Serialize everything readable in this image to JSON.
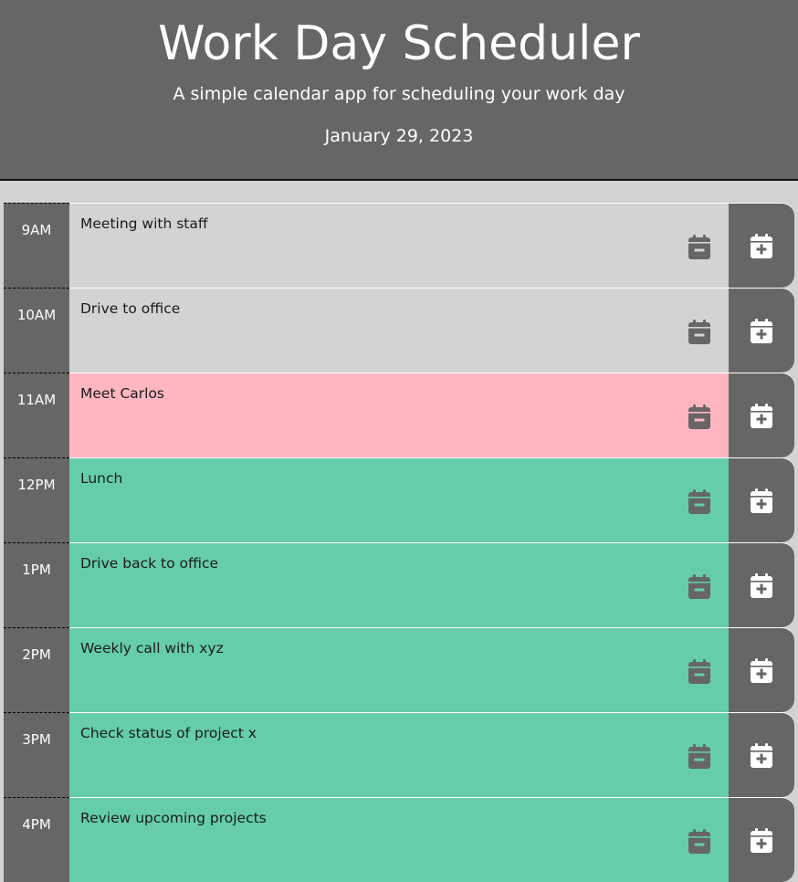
{
  "header": {
    "title": "Work Day Scheduler",
    "subtitle": "A simple calendar app for scheduling your work day",
    "date": "January 29, 2023"
  },
  "colors": {
    "header_bg": "#666666",
    "past": "#d3d3d3",
    "present": "#ffb6c1",
    "future": "#66cdaa",
    "button_bg": "#666666"
  },
  "icons": {
    "clear": "calendar-minus-icon",
    "save": "calendar-plus-icon"
  },
  "rows": [
    {
      "hour": "9AM",
      "text": "Meeting with staff",
      "state": "past"
    },
    {
      "hour": "10AM",
      "text": "Drive to office",
      "state": "past"
    },
    {
      "hour": "11AM",
      "text": "Meet Carlos",
      "state": "present"
    },
    {
      "hour": "12PM",
      "text": "Lunch",
      "state": "future"
    },
    {
      "hour": "1PM",
      "text": "Drive back to office",
      "state": "future"
    },
    {
      "hour": "2PM",
      "text": "Weekly call with xyz",
      "state": "future"
    },
    {
      "hour": "3PM",
      "text": "Check status of project x",
      "state": "future"
    },
    {
      "hour": "4PM",
      "text": "Review upcoming projects",
      "state": "future"
    }
  ]
}
